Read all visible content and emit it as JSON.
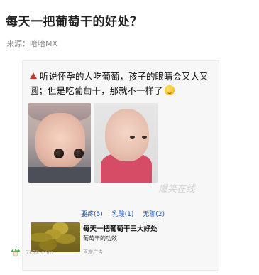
{
  "article": {
    "title": "每天一把葡萄干的好处？",
    "source": "来源：哈哈MX"
  },
  "post": {
    "text": "听说怀孕的人吃葡萄，孩子的眼睛会又大又圆；但是吃葡萄干，那就不一样了",
    "watermark": "爆笑在线"
  },
  "tags": [
    "要疼(5)",
    "乳酸(1)",
    "无聊(2)"
  ],
  "ad": {
    "title": "每天一把葡萄干三大好处",
    "subtitle": "葡萄干的功效",
    "tag": "百度广告"
  },
  "footer": {
    "logo_text": "7k7k.com"
  }
}
